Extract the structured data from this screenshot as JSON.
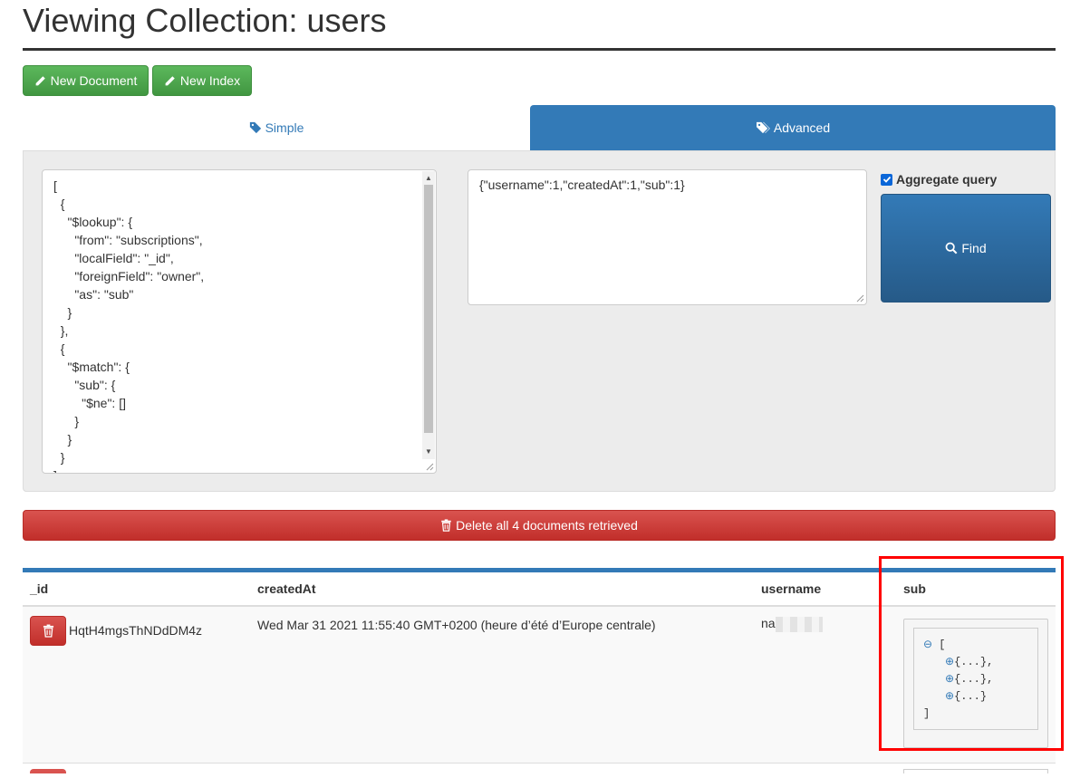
{
  "page": {
    "title": "Viewing Collection: users"
  },
  "toolbar": {
    "new_document": "New Document",
    "new_index": "New Index"
  },
  "tabs": {
    "simple": "Simple",
    "advanced": "Advanced",
    "active": "advanced"
  },
  "query": {
    "pipeline": "[\n  {\n    \"$lookup\": {\n      \"from\": \"subscriptions\",\n      \"localField\": \"_id\",\n      \"foreignField\": \"owner\",\n      \"as\": \"sub\"\n    }\n  },\n  {\n    \"$match\": {\n      \"sub\": {\n        \"$ne\": []\n      }\n    }\n  }\n]",
    "projection": "{\"username\":1,\"createdAt\":1,\"sub\":1}",
    "aggregate_label": "Aggregate query",
    "aggregate_checked": true,
    "find_label": "Find"
  },
  "delete_all": {
    "label": "Delete all 4 documents retrieved"
  },
  "table": {
    "columns": [
      "_id",
      "createdAt",
      "username",
      "sub"
    ],
    "rows": [
      {
        "_id": "HqtH4mgsThNDdDM4z",
        "createdAt": "Wed Mar 31 2021 11:55:40 GMT+0200 (heure d’été d’Europe centrale)",
        "username": "na",
        "sub": {
          "open": "[",
          "items": [
            "{...},",
            "{...},",
            "{...}"
          ],
          "close": "]"
        }
      }
    ]
  },
  "colors": {
    "primary": "#337ab7",
    "success": "#5cb85c",
    "danger": "#d9534f",
    "highlight": "#ff0000"
  },
  "icons": {
    "new_document": "pencil-icon",
    "new_index": "pencil-icon",
    "simple_tab": "tag-icon",
    "advanced_tab": "tags-icon",
    "find": "search-icon",
    "delete": "trash-icon",
    "collapse": "minus-circle-icon",
    "expand": "plus-circle-icon"
  }
}
